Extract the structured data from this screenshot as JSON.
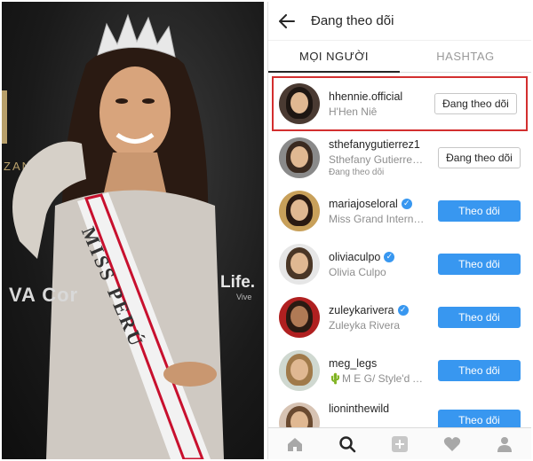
{
  "photo": {
    "sash_text": "MISS PERÚ",
    "sponsor_left": "VA Cor",
    "sponsor_right": "Life.",
    "sponsor_right_small": "Vive",
    "side_text": "ZANO"
  },
  "header": {
    "title": "Đang theo dõi"
  },
  "tabs": [
    {
      "label": "MỌI NGƯỜI",
      "active": true
    },
    {
      "label": "HASHTAG",
      "active": false
    }
  ],
  "accounts": [
    {
      "username": "hhennie.official",
      "name": "H'Hen Niê",
      "note": "",
      "verified": false,
      "button": "Đang theo dõi",
      "following": true
    },
    {
      "username": "sthefanygutierrez1",
      "name": "Sthefany Gutierrez...",
      "note": "Đang theo dõi",
      "verified": false,
      "button": "Đang theo dõi",
      "following": true
    },
    {
      "username": "mariajoseloral",
      "name": "Miss Grand Internati...",
      "note": "",
      "verified": true,
      "button": "Theo dõi",
      "following": false
    },
    {
      "username": "oliviaculpo",
      "name": "Olivia Culpo",
      "note": "",
      "verified": true,
      "button": "Theo dõi",
      "following": false
    },
    {
      "username": "zuleykarivera",
      "name": "Zuleyka Rivera",
      "note": "",
      "verified": true,
      "button": "Theo dõi",
      "following": false
    },
    {
      "username": "meg_legs",
      "name": "🌵M E G/ Style'd Av...",
      "note": "",
      "verified": false,
      "button": "Theo dõi",
      "following": false
    },
    {
      "username": "lioninthewild",
      "name": "",
      "note": "",
      "verified": false,
      "button": "Theo dõi",
      "following": false
    }
  ],
  "colors": {
    "accent": "#3897f0",
    "highlight": "#d32f2f"
  },
  "icons": [
    "back-arrow-icon",
    "home-icon",
    "search-icon",
    "add-icon",
    "heart-icon",
    "profile-icon"
  ]
}
